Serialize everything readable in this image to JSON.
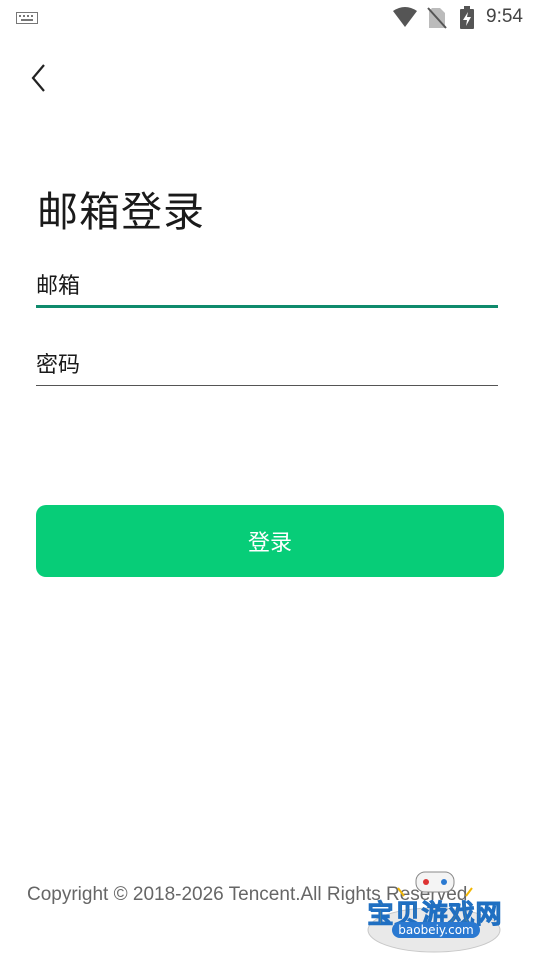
{
  "status_bar": {
    "time": "9:54"
  },
  "title": "邮箱登录",
  "form": {
    "email_placeholder": "邮箱",
    "password_placeholder": "密码",
    "login_label": "登录"
  },
  "footer": {
    "copyright": "Copyright © 2018-2026 Tencent.All Rights Reserved"
  },
  "watermark": {
    "brand": "宝贝游戏网",
    "url": "baobeiy.com"
  },
  "colors": {
    "accent": "#07cd78",
    "focus_underline": "#0f8a6c"
  }
}
